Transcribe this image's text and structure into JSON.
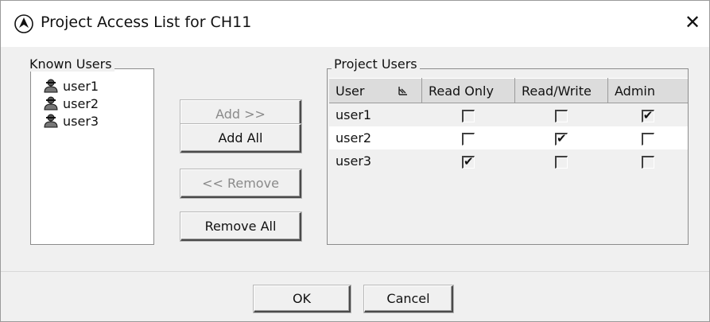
{
  "window": {
    "title": "Project Access List for CH11",
    "close_glyph": "✕"
  },
  "known_users": {
    "legend": "Known Users",
    "items": [
      {
        "label": "user1",
        "icon": "user-icon"
      },
      {
        "label": "user2",
        "icon": "user-icon"
      },
      {
        "label": "user3",
        "icon": "user-icon"
      }
    ]
  },
  "actions": {
    "add": "Add >>",
    "add_all": "Add All",
    "remove": "<< Remove",
    "remove_all": "Remove All"
  },
  "project_users": {
    "legend": "Project Users",
    "columns": [
      "User",
      "Read Only",
      "Read/Write",
      "Admin"
    ],
    "rows": [
      {
        "user": "user1",
        "read_only": false,
        "read_write": false,
        "admin": true
      },
      {
        "user": "user2",
        "read_only": false,
        "read_write": true,
        "admin": false
      },
      {
        "user": "user3",
        "read_only": true,
        "read_write": false,
        "admin": false
      }
    ]
  },
  "footer": {
    "ok": "OK",
    "cancel": "Cancel"
  }
}
